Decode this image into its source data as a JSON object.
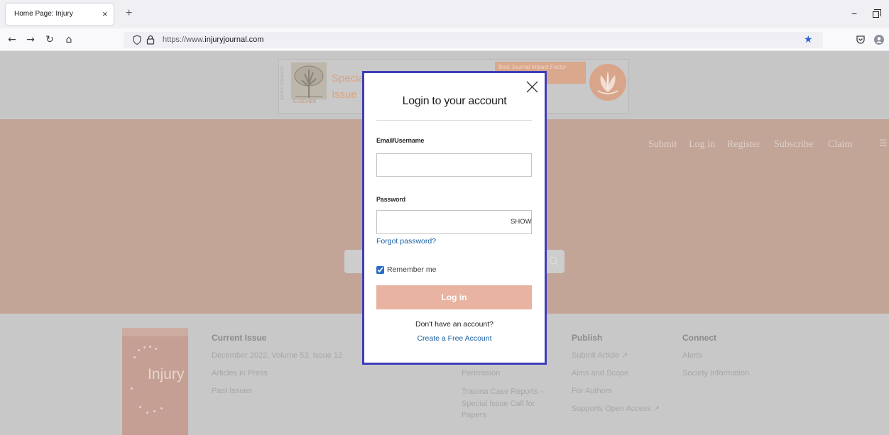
{
  "browser": {
    "tab_title": "Home Page: Injury",
    "url_scheme": "https://www.",
    "url_domain": "injuryjournal.com",
    "glyphs": {
      "tab_close": "×",
      "new_tab": "+",
      "minimize": "−",
      "back": "←",
      "forward": "→",
      "reload": "↻",
      "home": "⌂",
      "bookmark": "★"
    },
    "icons": [
      "tab-close-icon",
      "new-tab-icon",
      "minimize-icon",
      "restore-window-icon",
      "back-arrow-icon",
      "forward-arrow-icon",
      "reload-icon",
      "home-icon",
      "tracking-shield-icon",
      "lock-icon",
      "bookmark-star-icon",
      "pocket-icon",
      "profile-icon"
    ]
  },
  "advertisement": {
    "label": "ADVERTISEMENT",
    "publisher": "ELSEVIER",
    "headline_line1": "Special",
    "headline_line2": "Issue",
    "badge_text": "Best Journal Impact Factor"
  },
  "site_nav": {
    "items": [
      "Submit",
      "Log in",
      "Register",
      "Subscribe",
      "Claim"
    ],
    "menu_glyph": "☰"
  },
  "site_search": {
    "placeholder": "",
    "icon": "search-icon"
  },
  "footer": {
    "cover_title": "Injury",
    "current_issue": {
      "heading": "Current Issue",
      "links": [
        "December 2022, Volume 53, Issue 12",
        "Articles in Press",
        "Past Issues"
      ]
    },
    "partially_hidden_column": {
      "links": [
        "Permission",
        "Trauma Case Reports – Special Issue Call for Papers"
      ]
    },
    "publish": {
      "heading": "Publish",
      "links": [
        "Submit Article ↗",
        "Aims and Scope",
        "For Authors",
        "Supports Open Access ↗"
      ]
    },
    "connect": {
      "heading": "Connect",
      "links": [
        "Alerts",
        "Society Information"
      ]
    }
  },
  "login_modal": {
    "title": "Login to your account",
    "email_label": "Email/Username",
    "email_value": "",
    "password_label": "Password",
    "password_value": "",
    "show_password": "SHOW",
    "forgot_password": "Forgot password?",
    "remember_me": "Remember me",
    "remember_me_checked": true,
    "submit": "Log in",
    "no_account": "Don't have an account?",
    "create_account": "Create a Free Account",
    "close_icon": "close-icon"
  },
  "colors": {
    "modal_border": "#3d3dbb",
    "link": "#1a5fa2",
    "login_button": "#e9b3a1",
    "hero_background": "#c3a598",
    "bookmark_star": "#2a62d1",
    "ad_accent": "#dea27c",
    "checkbox": "#2b6cc4"
  }
}
